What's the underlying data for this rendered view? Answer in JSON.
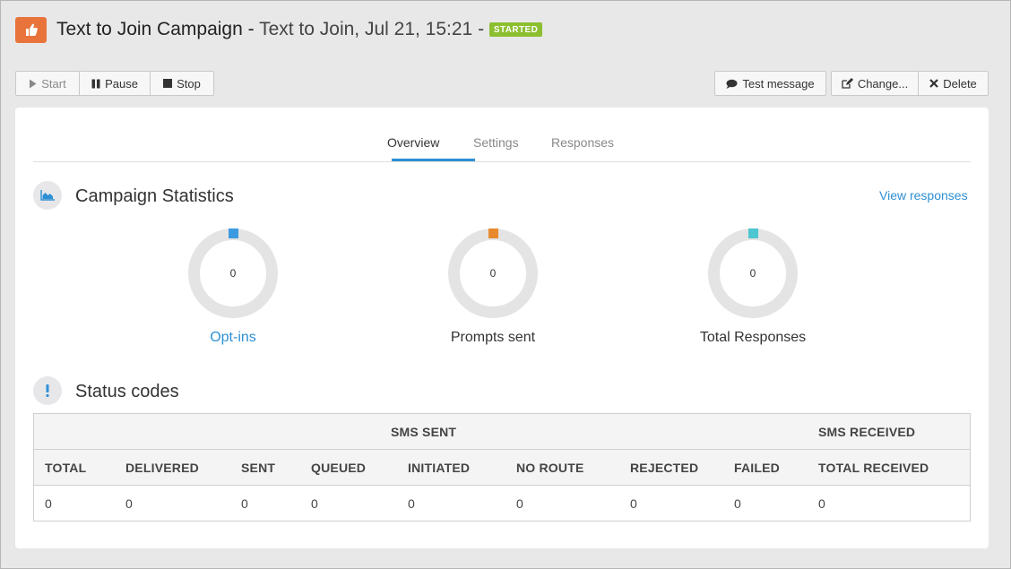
{
  "header": {
    "icon": "thumbs-up-icon",
    "campaign_name": "Text to Join Campaign",
    "separator": " - ",
    "subtitle": "Text to Join, Jul 21, 15:21",
    "separator2": " - ",
    "status_badge": "STARTED"
  },
  "toolbar": {
    "start_label": "Start",
    "pause_label": "Pause",
    "stop_label": "Stop",
    "test_message_label": "Test message",
    "change_label": "Change...",
    "delete_label": "Delete"
  },
  "tabs": [
    {
      "label": "Overview",
      "active": true
    },
    {
      "label": "Settings",
      "active": false
    },
    {
      "label": "Responses",
      "active": false
    }
  ],
  "campaign_statistics": {
    "title": "Campaign Statistics",
    "view_responses_link": "View responses",
    "stats": [
      {
        "label": "Opt-ins",
        "value": "0",
        "color": "#3a9be0"
      },
      {
        "label": "Prompts sent",
        "value": "0",
        "color": "#e8892e"
      },
      {
        "label": "Total Responses",
        "value": "0",
        "color": "#4cc6d0"
      }
    ]
  },
  "status_codes": {
    "title": "Status codes",
    "group_headers": {
      "sms_sent": "SMS SENT",
      "sms_received": "SMS RECEIVED"
    },
    "columns": [
      "TOTAL",
      "DELIVERED",
      "SENT",
      "QUEUED",
      "INITIATED",
      "NO ROUTE",
      "REJECTED",
      "FAILED",
      "TOTAL RECEIVED"
    ],
    "values": [
      "0",
      "0",
      "0",
      "0",
      "0",
      "0",
      "0",
      "0",
      "0"
    ]
  },
  "colors": {
    "accent": "#2e8fd4",
    "brand": "#e8743b",
    "started": "#8cbf2f"
  }
}
